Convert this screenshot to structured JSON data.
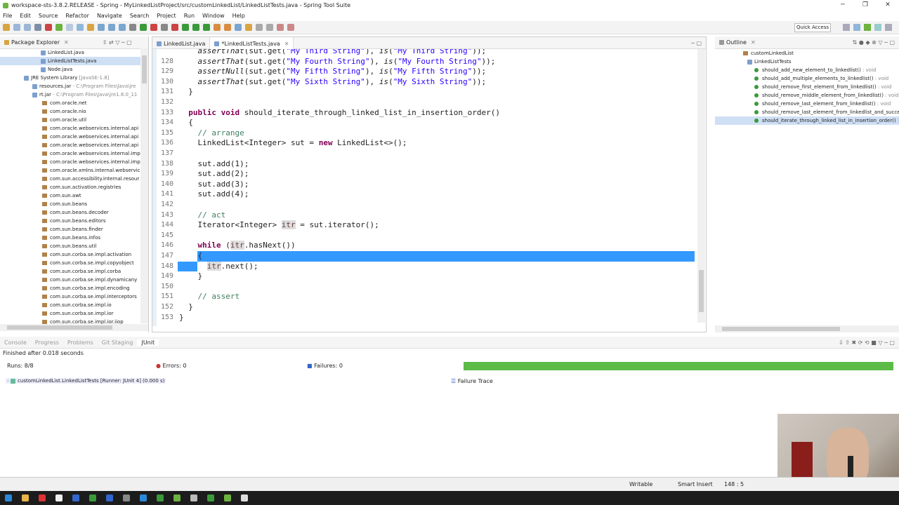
{
  "window": {
    "title": "workspace-sts-3.8.2.RELEASE - Spring - MyLinkedListProject/src/customLinkedList/LinkedListTests.java - Spring Tool Suite"
  },
  "menu": [
    "File",
    "Edit",
    "Source",
    "Refactor",
    "Navigate",
    "Search",
    "Project",
    "Run",
    "Window",
    "Help"
  ],
  "quick_access": "Quick Access",
  "package_explorer": {
    "title": "Package Explorer",
    "items": [
      {
        "label": "LinkedList.java",
        "extra": "",
        "indent": 58,
        "kind": "java"
      },
      {
        "label": "LinkedListTests.java",
        "extra": "",
        "indent": 58,
        "kind": "java-selected"
      },
      {
        "label": "Node.java",
        "extra": "",
        "indent": 58,
        "kind": "java"
      },
      {
        "label": "JRE System Library",
        "extra": " [JavaSE-1.8]",
        "indent": 34,
        "kind": "lib"
      },
      {
        "label": "resources.jar",
        "extra": " - C:\\Program Files\\Java\\jre",
        "indent": 46,
        "kind": "jar"
      },
      {
        "label": "rt.jar",
        "extra": " - C:\\Program Files\\Java\\jre1.8.0_11",
        "indent": 46,
        "kind": "jar"
      },
      {
        "label": "com.oracle.net",
        "extra": "",
        "indent": 60,
        "kind": "pkg"
      },
      {
        "label": "com.oracle.nio",
        "extra": "",
        "indent": 60,
        "kind": "pkg"
      },
      {
        "label": "com.oracle.util",
        "extra": "",
        "indent": 60,
        "kind": "pkg"
      },
      {
        "label": "com.oracle.webservices.internal.api",
        "extra": "",
        "indent": 60,
        "kind": "pkg"
      },
      {
        "label": "com.oracle.webservices.internal.api",
        "extra": "",
        "indent": 60,
        "kind": "pkg"
      },
      {
        "label": "com.oracle.webservices.internal.api",
        "extra": "",
        "indent": 60,
        "kind": "pkg"
      },
      {
        "label": "com.oracle.webservices.internal.imp",
        "extra": "",
        "indent": 60,
        "kind": "pkg"
      },
      {
        "label": "com.oracle.webservices.internal.imp",
        "extra": "",
        "indent": 60,
        "kind": "pkg"
      },
      {
        "label": "com.oracle.xmlns.internal.webservic",
        "extra": "",
        "indent": 60,
        "kind": "pkg"
      },
      {
        "label": "com.sun.accessibility.internal.resour",
        "extra": "",
        "indent": 60,
        "kind": "pkg"
      },
      {
        "label": "com.sun.activation.registries",
        "extra": "",
        "indent": 60,
        "kind": "pkg"
      },
      {
        "label": "com.sun.awt",
        "extra": "",
        "indent": 60,
        "kind": "pkg"
      },
      {
        "label": "com.sun.beans",
        "extra": "",
        "indent": 60,
        "kind": "pkg"
      },
      {
        "label": "com.sun.beans.decoder",
        "extra": "",
        "indent": 60,
        "kind": "pkg"
      },
      {
        "label": "com.sun.beans.editors",
        "extra": "",
        "indent": 60,
        "kind": "pkg"
      },
      {
        "label": "com.sun.beans.finder",
        "extra": "",
        "indent": 60,
        "kind": "pkg"
      },
      {
        "label": "com.sun.beans.infos",
        "extra": "",
        "indent": 60,
        "kind": "pkg"
      },
      {
        "label": "com.sun.beans.util",
        "extra": "",
        "indent": 60,
        "kind": "pkg"
      },
      {
        "label": "com.sun.corba.se.impl.activation",
        "extra": "",
        "indent": 60,
        "kind": "pkg"
      },
      {
        "label": "com.sun.corba.se.impl.copyobject",
        "extra": "",
        "indent": 60,
        "kind": "pkg"
      },
      {
        "label": "com.sun.corba.se.impl.corba",
        "extra": "",
        "indent": 60,
        "kind": "pkg"
      },
      {
        "label": "com.sun.corba.se.impl.dynamicany",
        "extra": "",
        "indent": 60,
        "kind": "pkg"
      },
      {
        "label": "com.sun.corba.se.impl.encoding",
        "extra": "",
        "indent": 60,
        "kind": "pkg"
      },
      {
        "label": "com.sun.corba.se.impl.interceptors",
        "extra": "",
        "indent": 60,
        "kind": "pkg"
      },
      {
        "label": "com.sun.corba.se.impl.io",
        "extra": "",
        "indent": 60,
        "kind": "pkg"
      },
      {
        "label": "com.sun.corba.se.impl.ior",
        "extra": "",
        "indent": 60,
        "kind": "pkg"
      },
      {
        "label": "com.sun.corba.se.impl.ior.iiop",
        "extra": "",
        "indent": 60,
        "kind": "pkg"
      }
    ]
  },
  "editor": {
    "tabs": [
      {
        "label": "LinkedList.java",
        "active": false
      },
      {
        "label": "*LinkedListTests.java",
        "active": true
      }
    ],
    "lines": [
      {
        "n": "",
        "h": "    <span class=\"it\">assertThat</span>(sut.get(<span class=\"str\">\"My Third String\"</span>), <span class=\"it\">is</span>(<span class=\"str\">\"My Third String\"</span>));"
      },
      {
        "n": "128",
        "h": "    <span class=\"it\">assertThat</span>(sut.get(<span class=\"str\">\"My Fourth String\"</span>), <span class=\"it\">is</span>(<span class=\"str\">\"My Fourth String\"</span>));"
      },
      {
        "n": "129",
        "h": "    <span class=\"it\">assertNull</span>(sut.get(<span class=\"str\">\"My Fifth String\"</span>), <span class=\"it\">is</span>(<span class=\"str\">\"My Fifth String\"</span>));"
      },
      {
        "n": "130",
        "h": "    <span class=\"it\">assertThat</span>(sut.get(<span class=\"str\">\"My Sixth String\"</span>), <span class=\"it\">is</span>(<span class=\"str\">\"My Sixth String\"</span>));"
      },
      {
        "n": "131",
        "h": "  }"
      },
      {
        "n": "132",
        "h": ""
      },
      {
        "n": "133",
        "h": "  <span class=\"kw\">public void</span> should_iterate_through_linked_list_in_insertion_order()"
      },
      {
        "n": "134",
        "h": "  {"
      },
      {
        "n": "135",
        "h": "    <span class=\"cm\">// arrange</span>"
      },
      {
        "n": "136",
        "h": "    LinkedList&lt;Integer&gt; sut = <span class=\"kw\">new</span> LinkedList&lt;&gt;();"
      },
      {
        "n": "137",
        "h": ""
      },
      {
        "n": "138",
        "h": "    sut.add(1);"
      },
      {
        "n": "139",
        "h": "    sut.add(2);"
      },
      {
        "n": "140",
        "h": "    sut.add(3);"
      },
      {
        "n": "141",
        "h": "    sut.add(4);"
      },
      {
        "n": "142",
        "h": ""
      },
      {
        "n": "143",
        "h": "    <span class=\"cm\">// act</span>"
      },
      {
        "n": "144",
        "h": "    Iterator&lt;Integer&gt; <span class=\"loc\">itr</span> = sut.iterator();"
      },
      {
        "n": "145",
        "h": ""
      },
      {
        "n": "146",
        "h": "    <span class=\"kw\">while</span> (<span class=\"loc\">itr</span>.hasNext())"
      },
      {
        "n": "147",
        "h": "    {",
        "sel": true
      },
      {
        "n": "148",
        "h": "      <span class=\"loc\">itr</span>.next();",
        "selpart": true
      },
      {
        "n": "149",
        "h": "    }"
      },
      {
        "n": "150",
        "h": ""
      },
      {
        "n": "151",
        "h": "    <span class=\"cm\">// assert</span>"
      },
      {
        "n": "152",
        "h": "  }"
      },
      {
        "n": "153",
        "h": "}"
      }
    ]
  },
  "outline": {
    "title": "Outline",
    "items": [
      {
        "label": "customLinkedList",
        "extra": "",
        "indent": 40,
        "kind": "pkg"
      },
      {
        "label": "LinkedListTests",
        "extra": "",
        "indent": 46,
        "kind": "class"
      },
      {
        "label": "should_add_new_element_to_linkedlist()",
        "extra": " : void",
        "indent": 56,
        "kind": "method"
      },
      {
        "label": "should_add_multiple_elements_to_linkedlist()",
        "extra": " : void",
        "indent": 56,
        "kind": "method"
      },
      {
        "label": "should_remove_first_element_from_linkedlist()",
        "extra": " : void",
        "indent": 56,
        "kind": "method"
      },
      {
        "label": "should_remove_middle_element_from_linkedlist()",
        "extra": " : void",
        "indent": 56,
        "kind": "method"
      },
      {
        "label": "should_remove_last_element_from_linkedlist()",
        "extra": " : void",
        "indent": 56,
        "kind": "method"
      },
      {
        "label": "should_remove_last_element_from_linkedlist_and_successfu",
        "extra": "",
        "indent": 56,
        "kind": "method"
      },
      {
        "label": "should_iterate_through_linked_list_in_insertion_order()",
        "extra": " : voi",
        "indent": 56,
        "kind": "method-selected"
      }
    ]
  },
  "junit": {
    "tabs": [
      "Console",
      "Progress",
      "Problems",
      "Git Staging",
      "JUnit"
    ],
    "finished": "Finished after 0.018 seconds",
    "runs_label": "Runs:",
    "runs": "8/8",
    "errors_label": "Errors:",
    "errors": "0",
    "failures_label": "Failures:",
    "failures": "0",
    "progress": 1.0,
    "test": "customLinkedList.LinkedListTests [Runner: JUnit 4] (0.000 s)",
    "failure_trace": "Failure Trace"
  },
  "status": {
    "writable": "Writable",
    "insert": "Smart Insert",
    "position": "148 : 5"
  }
}
